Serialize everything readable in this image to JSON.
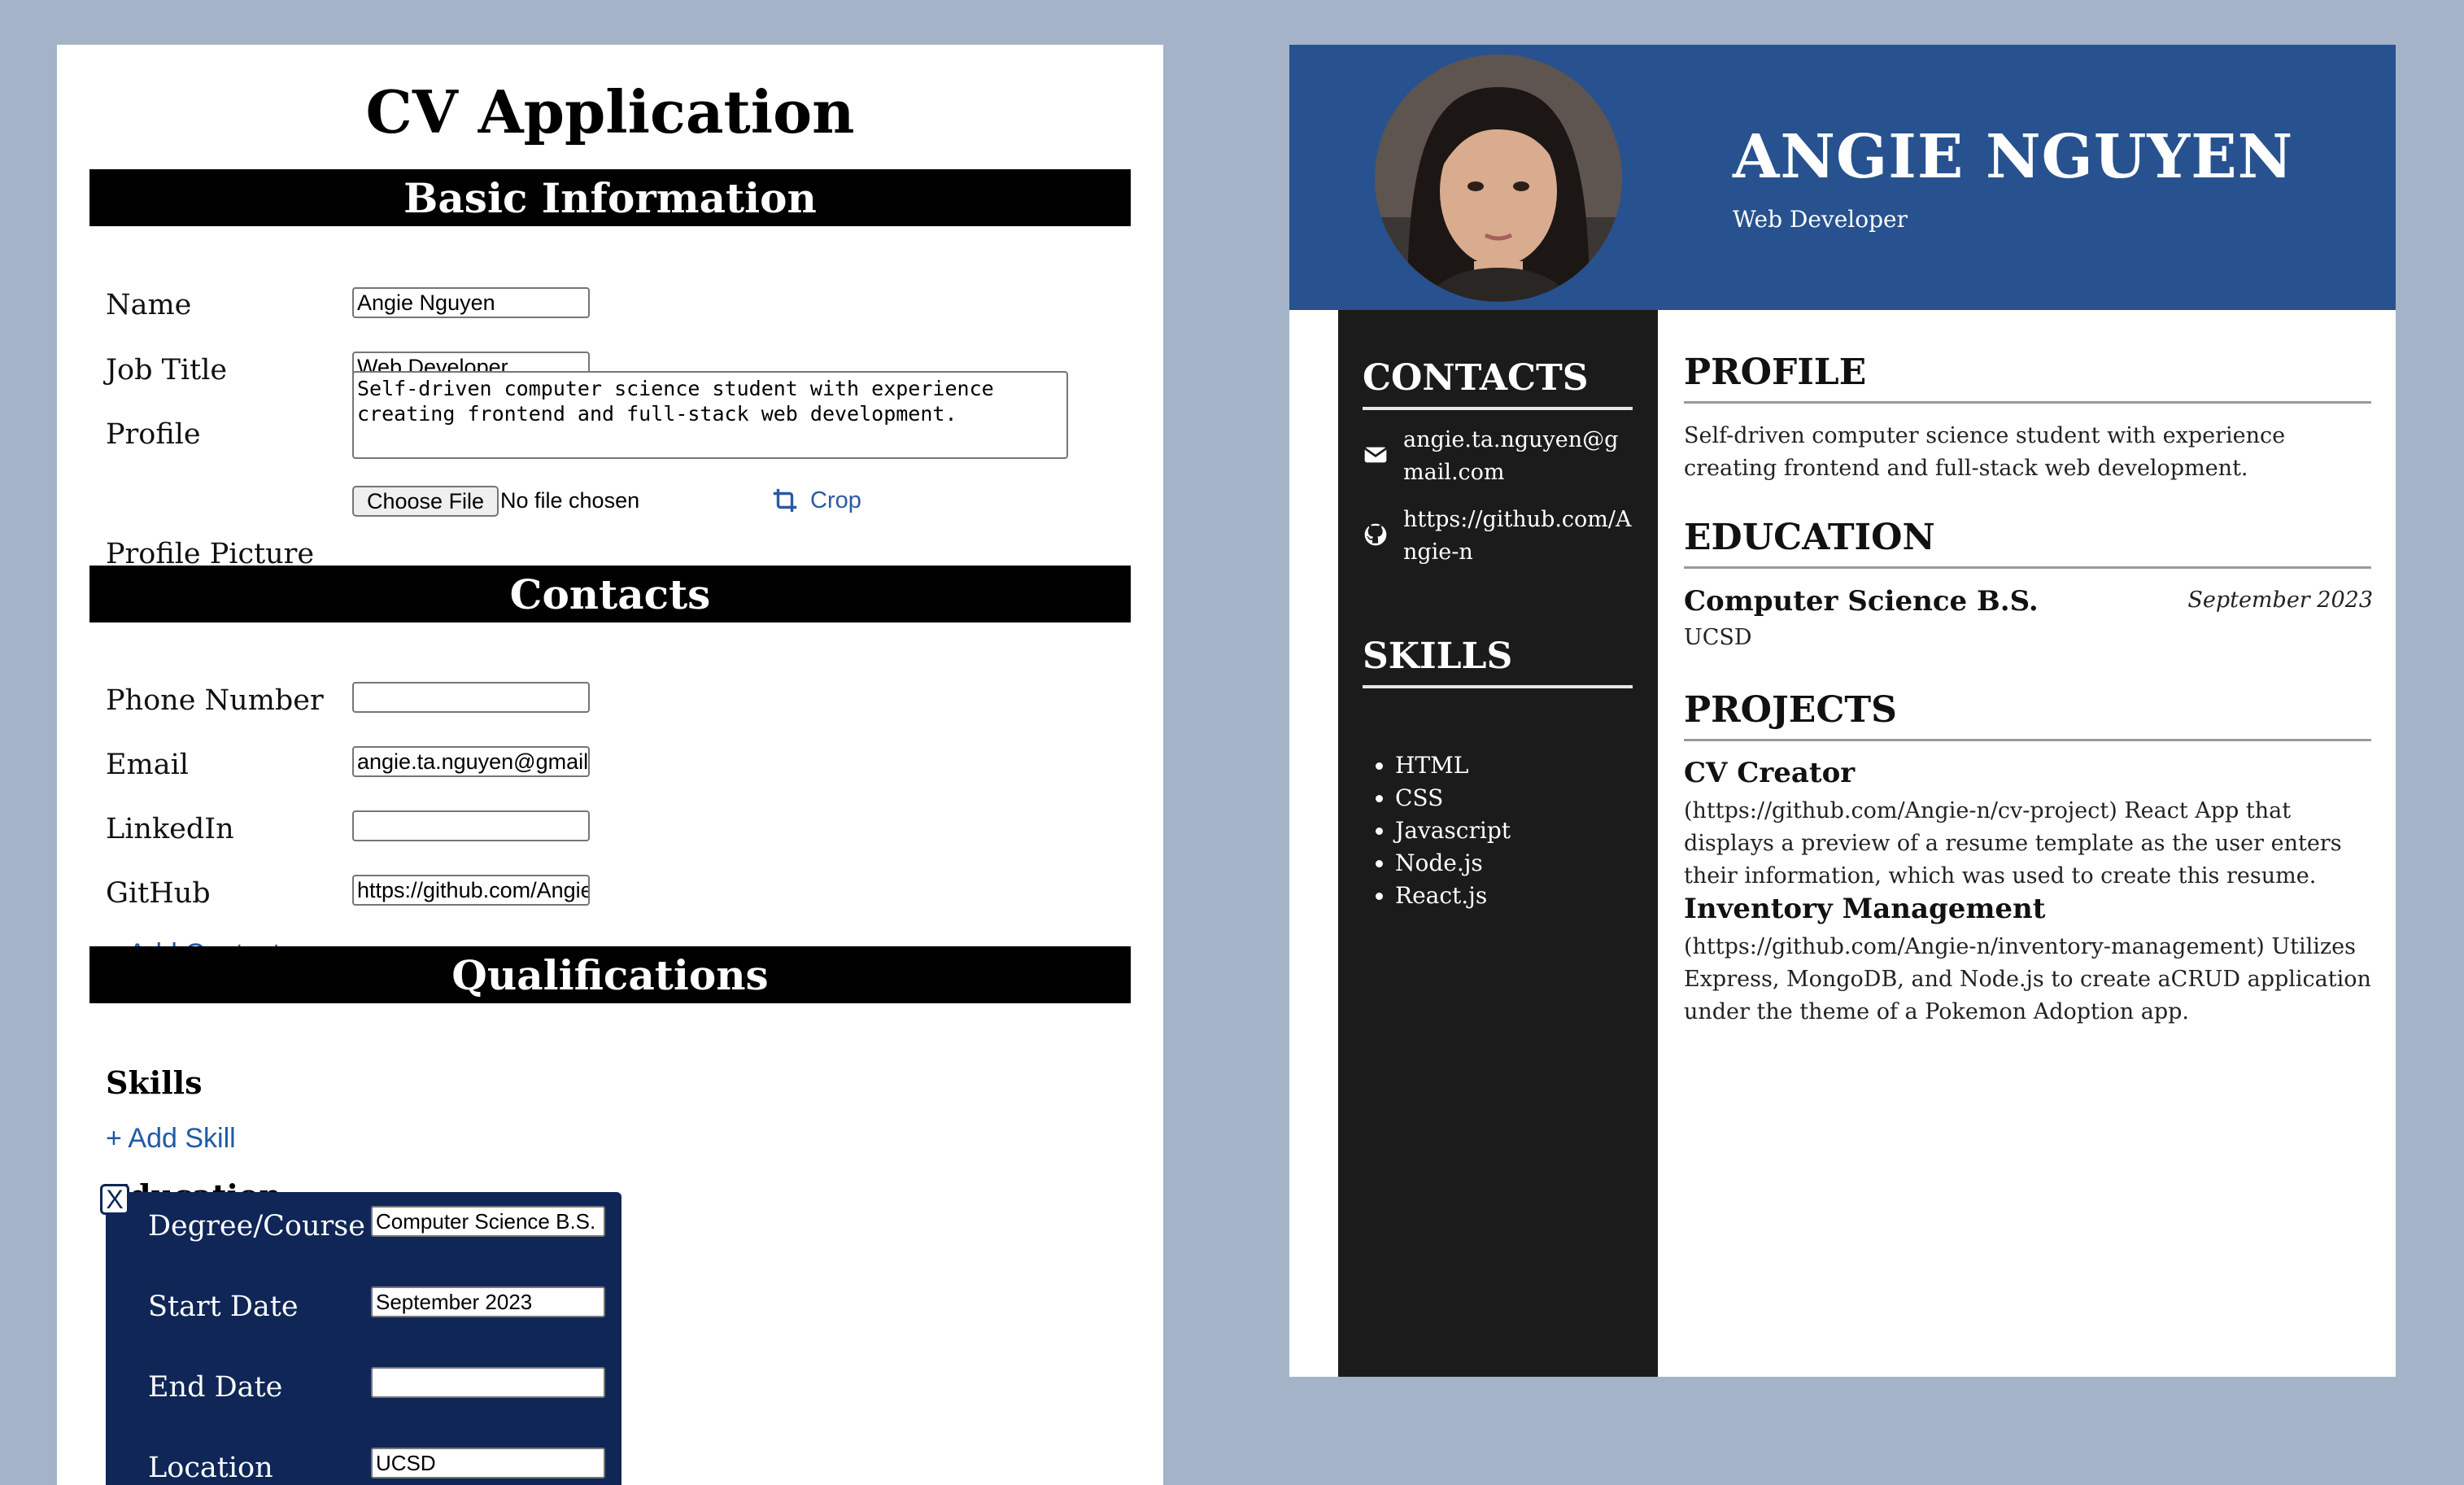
{
  "editor": {
    "title": "CV Application",
    "basic": {
      "heading": "Basic Information",
      "name_label": "Name",
      "name_value": "Angie Nguyen",
      "job_label": "Job Title",
      "job_value": "Web Developer",
      "profile_label": "Profile",
      "profile_value": "Self-driven computer science student with experience creating frontend and full-stack web development.",
      "picture_label": "Profile Picture",
      "choose_file": "Choose File",
      "no_file": "No file chosen",
      "crop": "Crop"
    },
    "contacts": {
      "heading": "Contacts",
      "phone_label": "Phone Number",
      "phone_value": "",
      "email_label": "Email",
      "email_value": "angie.ta.nguyen@gmail.com",
      "linkedin_label": "LinkedIn",
      "linkedin_value": "",
      "github_label": "GitHub",
      "github_value": "https://github.com/Angie-n",
      "add_contact": "+ Add Contact"
    },
    "qualifications": {
      "heading": "Qualifications",
      "skills_heading": "Skills",
      "add_skill": "+ Add Skill",
      "education_heading": "Education",
      "close": "X",
      "degree_label": "Degree/Course",
      "degree_value": "Computer Science B.S.",
      "start_label": "Start Date",
      "start_value": "September 2023",
      "end_label": "End Date",
      "end_value": "",
      "location_label": "Location",
      "location_value": "UCSD"
    }
  },
  "preview": {
    "name": "ANGIE NGUYEN",
    "job": "Web Developer",
    "contacts_heading": "CONTACTS",
    "email": "angie.ta.nguyen@gmail.com",
    "github": "https://github.com/Angie-n",
    "skills_heading": "SKILLS",
    "skills": [
      "HTML",
      "CSS",
      "Javascript",
      "Node.js",
      "React.js"
    ],
    "profile_heading": "PROFILE",
    "profile_text": "Self-driven computer science student with experience creating frontend and full-stack web development.",
    "education_heading": "EDUCATION",
    "degree": "Computer Science B.S.",
    "date": "September 2023",
    "school": "UCSD",
    "projects_heading": "PROJECTS",
    "projects": [
      {
        "title": "CV Creator",
        "desc": "(https://github.com/Angie-n/cv-project) React App that displays a preview of a resume template as the user enters their information, which was used to create this resume."
      },
      {
        "title": "Inventory Management",
        "desc": "(https://github.com/Angie-n/inventory-management) Utilizes Express, MongoDB, and Node.js to create aCRUD application under the theme of a Pokemon Adoption app."
      }
    ]
  },
  "colors": {
    "page_bg": "#a5b3c8",
    "header_blue": "#27528f",
    "sidebar_dark": "#1b1b1b",
    "edu_card_navy": "#0f2657",
    "link_blue": "#1f5aa6"
  }
}
